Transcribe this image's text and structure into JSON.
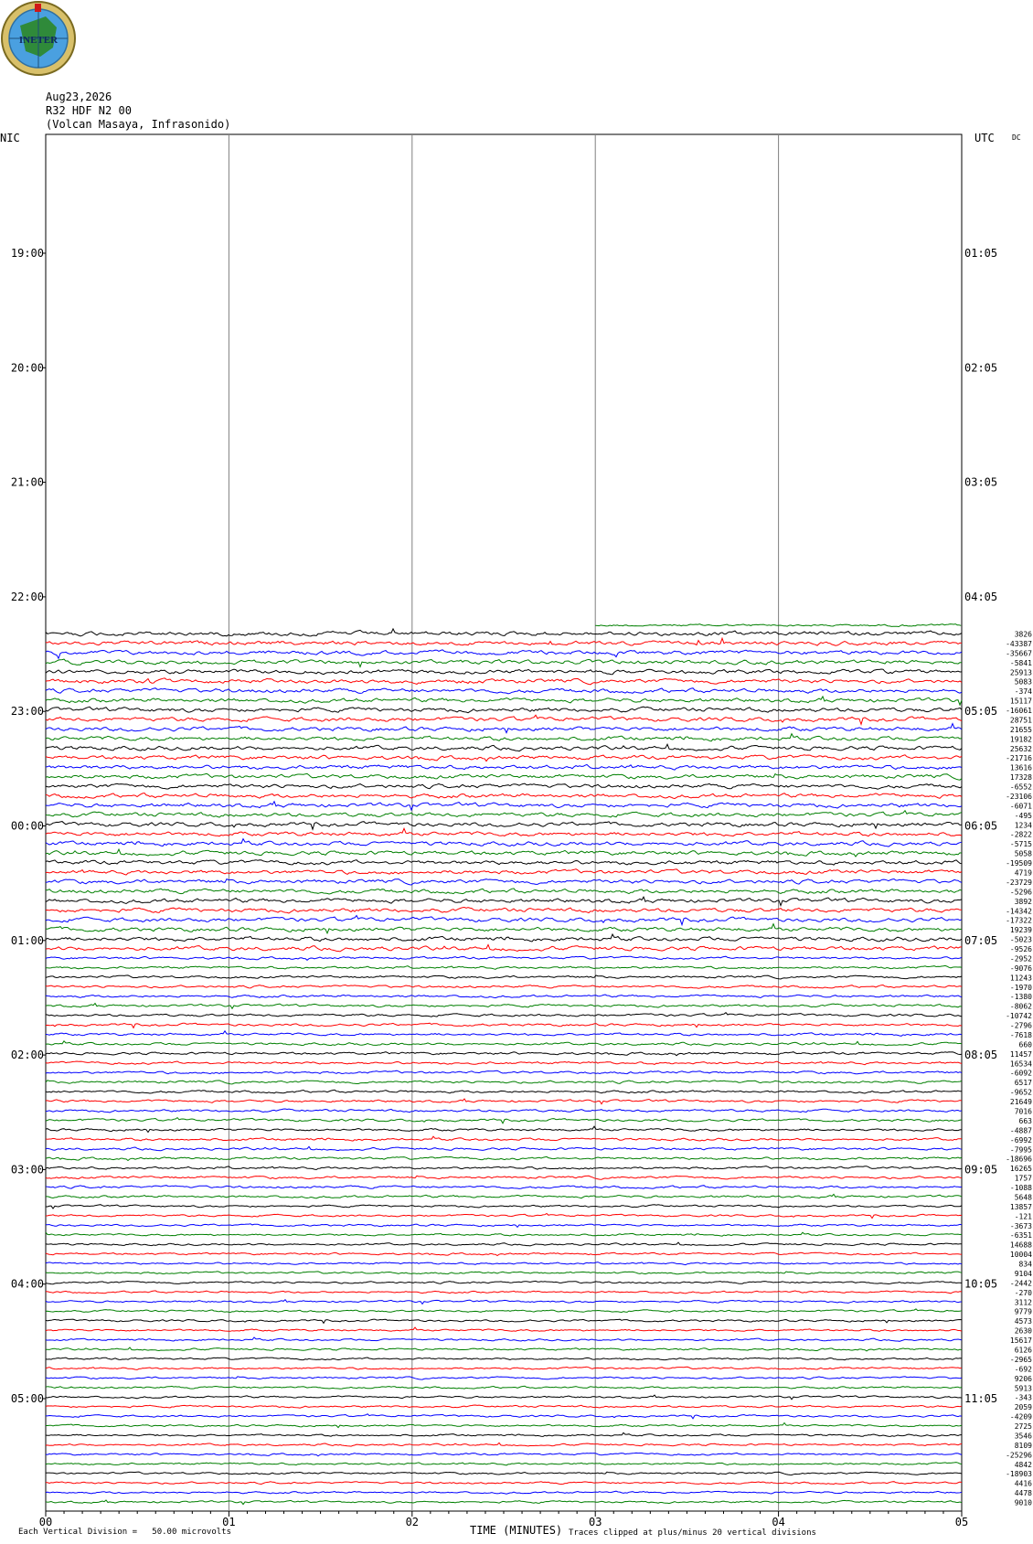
{
  "logo": {
    "text": "INETER",
    "colors": {
      "ring": "#c9b24a",
      "globe": "#3a8fd6",
      "land": "#2f7d3a"
    }
  },
  "header": {
    "date": "Aug23,2026",
    "channel": "R32 HDF N2 00",
    "station": "(Volcan Masaya, Infrasonido)"
  },
  "left_label": "NIC",
  "right_label": "UTC",
  "dc_label": "DC",
  "footer": {
    "scale_text": "Each Vertical Division =   50.00 microvolts",
    "xlabel": "TIME (MINUTES)",
    "clip_text": "Traces clipped at plus/minus 20 vertical divisions"
  },
  "colors": [
    "#000000",
    "#ff0000",
    "#0000ff",
    "#007f00"
  ],
  "chart_data": {
    "type": "line",
    "title": "",
    "xlabel": "TIME (MINUTES)",
    "x_ticks": [
      "00",
      "01",
      "02",
      "03",
      "04",
      "05"
    ],
    "xlim": [
      0,
      5
    ],
    "left_time_labels": [
      "19:00",
      "20:00",
      "21:00",
      "22:00",
      "23:00",
      "00:00",
      "01:00",
      "02:00",
      "03:00",
      "04:00",
      "05:00"
    ],
    "right_time_labels": [
      "01:05",
      "02:05",
      "03:05",
      "04:05",
      "05:05",
      "06:05",
      "07:05",
      "08:05",
      "09:05",
      "10:05",
      "11:05"
    ],
    "traces_per_hour": 12,
    "first_trace_start_minute": 3,
    "dc_offsets": [
      "3826",
      "-43387",
      "-35667",
      "-5841",
      "25913",
      "5083",
      "-374",
      "15117",
      "-16061",
      "28751",
      "21655",
      "19182",
      "25632",
      "-21716",
      "13616",
      "17328",
      "-6552",
      "-23106",
      "-6071",
      "-495",
      "1234",
      "-2822",
      "-5715",
      "5058",
      "-19509",
      "4719",
      "-23729",
      "-5296",
      "3892",
      "-14342",
      "-17322",
      "19239",
      "-5023",
      "-9526",
      "-2952",
      "-9076",
      "11243",
      "-1970",
      "-1380",
      "-8062",
      "-10742",
      "-2796",
      "-7618",
      "660",
      "11457",
      "16534",
      "-6092",
      "6517",
      "-9652",
      "21649",
      "7016",
      "663",
      "-4887",
      "-6992",
      "-7995",
      "-18696",
      "16265",
      "1757",
      "-1088",
      "5648",
      "13857",
      "-121",
      "-3673",
      "-6351",
      "14688",
      "10004",
      "834",
      "9104",
      "-2442",
      "-270",
      "3112",
      "9779",
      "4573",
      "2630",
      "15617",
      "6126",
      "-2965",
      "-692",
      "9206",
      "5913",
      "-343",
      "2059",
      "-4209",
      "2725",
      "3546",
      "8109",
      "-25296",
      "4842",
      "-18903",
      "4416",
      "4478",
      "9010"
    ]
  }
}
